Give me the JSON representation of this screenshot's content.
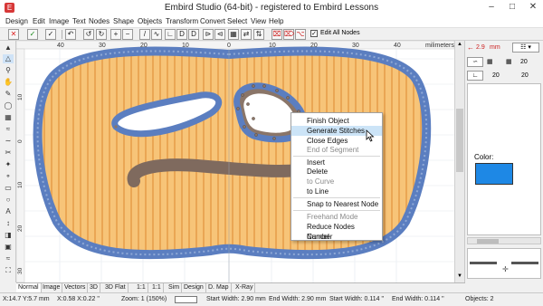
{
  "window": {
    "title": "Embird Studio (64-bit)  - registered to Embird Lessons"
  },
  "menu": [
    "Design",
    "Edit",
    "Image",
    "Text",
    "Nodes",
    "Shape",
    "Objects",
    "Transform",
    "Convert",
    "Select",
    "View",
    "Help"
  ],
  "toolbar": {
    "edit_all_nodes": "Edit All Nodes"
  },
  "ruler": {
    "unit": "milimeters",
    "top_labels": [
      "40",
      "30",
      "20",
      "10",
      "0",
      "10",
      "20",
      "30",
      "40"
    ],
    "left_labels": [
      "10",
      "0",
      "10",
      "20",
      "30"
    ]
  },
  "context_menu": {
    "items": [
      {
        "label": "Finish Object",
        "enabled": true
      },
      {
        "label": "Generate Stitches",
        "enabled": true,
        "highlighted": true
      },
      {
        "label": "Close Edges",
        "enabled": true
      },
      {
        "label": "End of Segment",
        "enabled": false
      },
      {
        "label": "Insert",
        "enabled": true
      },
      {
        "label": "Delete",
        "enabled": true
      },
      {
        "label": "to Curve",
        "enabled": false
      },
      {
        "label": "to Line",
        "enabled": true
      },
      {
        "label": "Snap to Nearest Node",
        "enabled": true
      },
      {
        "label": "Freehand Mode",
        "enabled": false
      },
      {
        "label": "Reduce Nodes Number",
        "enabled": true
      },
      {
        "label": "Cancel",
        "enabled": true
      }
    ]
  },
  "right_panel": {
    "size": "2.9",
    "size_unit": "mm",
    "density_a": "20",
    "density_b": "20",
    "density_c": "20",
    "color_label": "Color:",
    "color_swatch": "#1e88e5"
  },
  "tabs": [
    "Normal",
    "Image",
    "Vectors",
    "3D",
    "3D Flat",
    "1:1",
    "1:1",
    "Sim",
    "Design",
    "D. Map",
    "X-Ray"
  ],
  "status": {
    "coords": "X:14.7  Y:5.7 mm",
    "delta": "X:0.58  X:0.22 \"",
    "zoom": "Zoom: 1 (150%)",
    "start_width": "Start Width: 2.90 mm",
    "end_width": "End Width: 2.90 mm",
    "start_width_in": "Start Width: 0.114 \"",
    "end_width_in": "End Width: 0.114 \"",
    "objects": "Objects: 2"
  },
  "colors": {
    "fill_stripe_light": "#f7c478",
    "fill_stripe_dark": "#f0ac5c",
    "outline": "#5b7ec0",
    "brown": "#7f6a5e"
  }
}
